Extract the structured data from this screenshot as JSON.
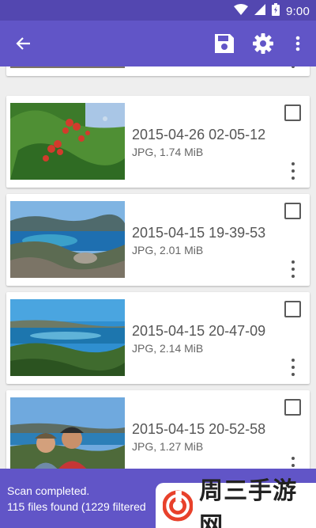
{
  "status_bar": {
    "time": "9:00"
  },
  "toolbar": {
    "back_icon": "arrow-left-icon",
    "save_icon": "save-icon",
    "settings_icon": "gear-icon",
    "more_icon": "more-vertical-icon"
  },
  "files": [
    {
      "date": "2015-04-26 02-05-12",
      "meta": "JPG, 1.74 MiB",
      "checked": false
    },
    {
      "date": "2015-04-15 19-39-53",
      "meta": "JPG, 2.01 MiB",
      "checked": false
    },
    {
      "date": "2015-04-15 20-47-09",
      "meta": "JPG, 2.14 MiB",
      "checked": false
    },
    {
      "date": "2015-04-15 20-52-58",
      "meta": "JPG, 1.27 MiB",
      "checked": false
    }
  ],
  "snackbar": {
    "line1": "Scan completed.",
    "line2": "115 files found (1229 filtered"
  },
  "watermark": {
    "text": "周三手游网"
  },
  "colors": {
    "status_bar": "#5347b0",
    "toolbar": "#6155c7",
    "snackbar": "#6155c7"
  }
}
